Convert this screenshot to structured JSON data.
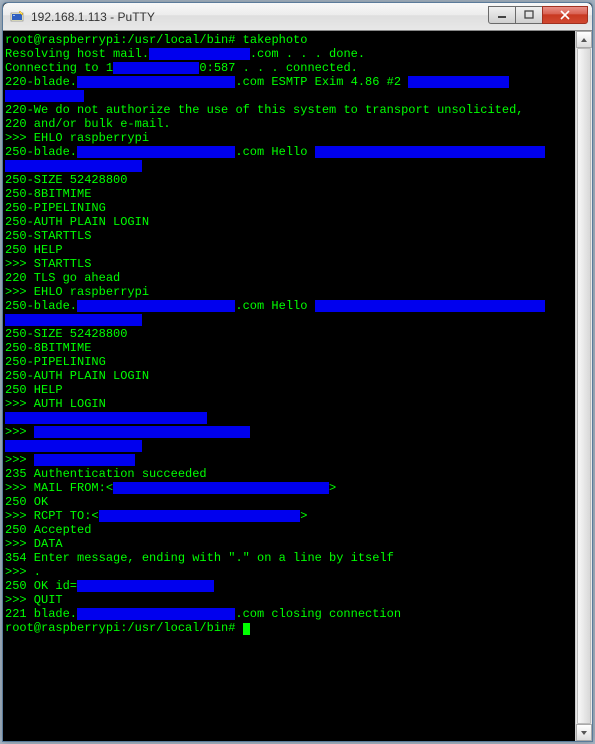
{
  "window": {
    "title": "192.168.1.113 - PuTTY"
  },
  "redact_color": "#0000ee",
  "terminal": {
    "lines": [
      {
        "segs": [
          {
            "t": "root@raspberrypi:/usr/local/bin# takephoto"
          }
        ]
      },
      {
        "segs": [
          {
            "t": "Resolving host mail."
          },
          {
            "r": 14
          },
          {
            "t": ".com . . . done."
          }
        ]
      },
      {
        "segs": [
          {
            "t": "Connecting to 1"
          },
          {
            "r": 12
          },
          {
            "t": "0:587 . . . connected."
          }
        ]
      },
      {
        "segs": [
          {
            "t": "220-blade."
          },
          {
            "r": 22
          },
          {
            "t": ".com ESMTP Exim 4.86 #2 "
          },
          {
            "r": 14
          }
        ]
      },
      {
        "segs": [
          {
            "r": 11
          }
        ]
      },
      {
        "segs": [
          {
            "t": "220-We do not authorize the use of this system to transport unsolicited, "
          }
        ]
      },
      {
        "segs": [
          {
            "t": "220 and/or bulk e-mail."
          }
        ]
      },
      {
        "segs": [
          {
            "t": ">>> EHLO raspberrypi"
          }
        ]
      },
      {
        "segs": [
          {
            "t": "250-blade."
          },
          {
            "r": 22
          },
          {
            "t": ".com Hello "
          },
          {
            "r": 32
          }
        ]
      },
      {
        "segs": [
          {
            "r": 19
          }
        ]
      },
      {
        "segs": [
          {
            "t": "250-SIZE 52428800"
          }
        ]
      },
      {
        "segs": [
          {
            "t": "250-8BITMIME"
          }
        ]
      },
      {
        "segs": [
          {
            "t": "250-PIPELINING"
          }
        ]
      },
      {
        "segs": [
          {
            "t": "250-AUTH PLAIN LOGIN"
          }
        ]
      },
      {
        "segs": [
          {
            "t": "250-STARTTLS"
          }
        ]
      },
      {
        "segs": [
          {
            "t": "250 HELP"
          }
        ]
      },
      {
        "segs": [
          {
            "t": ">>> STARTTLS"
          }
        ]
      },
      {
        "segs": [
          {
            "t": "220 TLS go ahead"
          }
        ]
      },
      {
        "segs": [
          {
            "t": ">>> EHLO raspberrypi"
          }
        ]
      },
      {
        "segs": [
          {
            "t": "250-blade."
          },
          {
            "r": 22
          },
          {
            "t": ".com Hello "
          },
          {
            "r": 32
          }
        ]
      },
      {
        "segs": [
          {
            "r": 19
          }
        ]
      },
      {
        "segs": [
          {
            "t": "250-SIZE 52428800"
          }
        ]
      },
      {
        "segs": [
          {
            "t": "250-8BITMIME"
          }
        ]
      },
      {
        "segs": [
          {
            "t": "250-PIPELINING"
          }
        ]
      },
      {
        "segs": [
          {
            "t": "250-AUTH PLAIN LOGIN"
          }
        ]
      },
      {
        "segs": [
          {
            "t": "250 HELP"
          }
        ]
      },
      {
        "segs": [
          {
            "t": ">>> AUTH LOGIN"
          }
        ]
      },
      {
        "segs": [
          {
            "r": 28
          }
        ]
      },
      {
        "segs": [
          {
            "t": ">>> "
          },
          {
            "r": 30
          }
        ]
      },
      {
        "segs": [
          {
            "r": 19
          }
        ]
      },
      {
        "segs": [
          {
            "t": ">>> "
          },
          {
            "r": 14
          }
        ]
      },
      {
        "segs": [
          {
            "t": "235 Authentication succeeded"
          }
        ]
      },
      {
        "segs": [
          {
            "t": ">>> MAIL FROM:<"
          },
          {
            "r": 30
          },
          {
            "t": ">"
          }
        ]
      },
      {
        "segs": [
          {
            "t": "250 OK"
          }
        ]
      },
      {
        "segs": [
          {
            "t": ">>> RCPT TO:<"
          },
          {
            "r": 28
          },
          {
            "t": ">"
          }
        ]
      },
      {
        "segs": [
          {
            "t": "250 Accepted"
          }
        ]
      },
      {
        "segs": [
          {
            "t": ">>> DATA"
          }
        ]
      },
      {
        "segs": [
          {
            "t": "354 Enter message, ending with \".\" on a line by itself"
          }
        ]
      },
      {
        "segs": [
          {
            "t": ">>> ."
          }
        ]
      },
      {
        "segs": [
          {
            "t": "250 OK id="
          },
          {
            "r": 19
          }
        ]
      },
      {
        "segs": [
          {
            "t": ">>> QUIT"
          }
        ]
      },
      {
        "segs": [
          {
            "t": "221 blade."
          },
          {
            "r": 22
          },
          {
            "t": ".com closing connection"
          }
        ]
      },
      {
        "segs": [
          {
            "t": "root@raspberrypi:/usr/local/bin# "
          },
          {
            "cursor": true
          }
        ]
      }
    ]
  }
}
